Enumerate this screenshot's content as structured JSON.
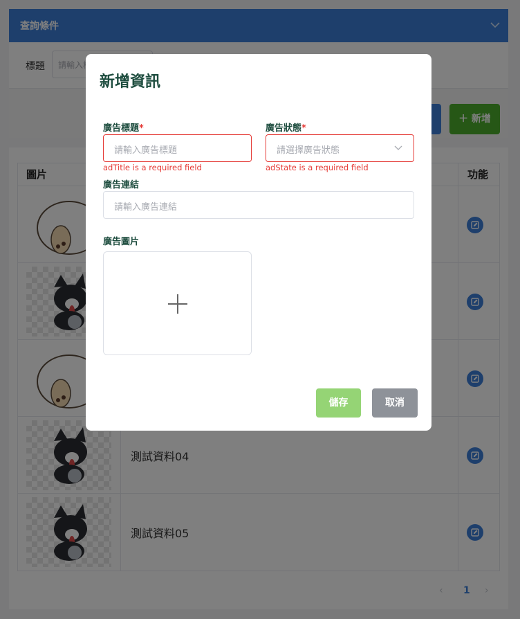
{
  "query": {
    "header_title": "查詢條件",
    "title_label": "標題",
    "title_placeholder": "請輸入標題",
    "add_label": "＋ 新增"
  },
  "table": {
    "headers": {
      "image": "圖片",
      "function": "功能"
    },
    "rows": [
      {
        "title": "",
        "image": "cat-bubble-tea-sticker"
      },
      {
        "title": "",
        "image": "dog-sticker"
      },
      {
        "title": "",
        "image": "cat-bubble-tea-sticker"
      },
      {
        "title": "測試資料04",
        "image": "dog-sticker"
      },
      {
        "title": "測試資料05",
        "image": "dog-sticker"
      }
    ]
  },
  "pagination": {
    "prev": "‹",
    "current": "1",
    "next": "›"
  },
  "modal": {
    "title": "新增資訊",
    "ad_title": {
      "label": "廣告標題",
      "required_mark": "*",
      "placeholder": "請輸入廣告標題",
      "error": "adTitle is a required field"
    },
    "ad_state": {
      "label": "廣告狀態",
      "required_mark": "*",
      "placeholder": "請選擇廣告狀態",
      "error": "adState is a required field"
    },
    "ad_link": {
      "label": "廣告連結",
      "placeholder": "請輸入廣告連結"
    },
    "ad_image": {
      "label": "廣告圖片"
    },
    "save_label": "儲存",
    "cancel_label": "取消"
  },
  "colors": {
    "primary": "#3d7fd9",
    "success": "#4caf2c",
    "save_disabled": "#95d475",
    "cancel": "#8e9299",
    "error": "#e53935",
    "label": "#1e4d3f"
  },
  "icons": {
    "collapse": "chevron-down-icon",
    "edit": "edit-icon",
    "upload": "plus-icon",
    "select": "chevron-down-icon"
  }
}
